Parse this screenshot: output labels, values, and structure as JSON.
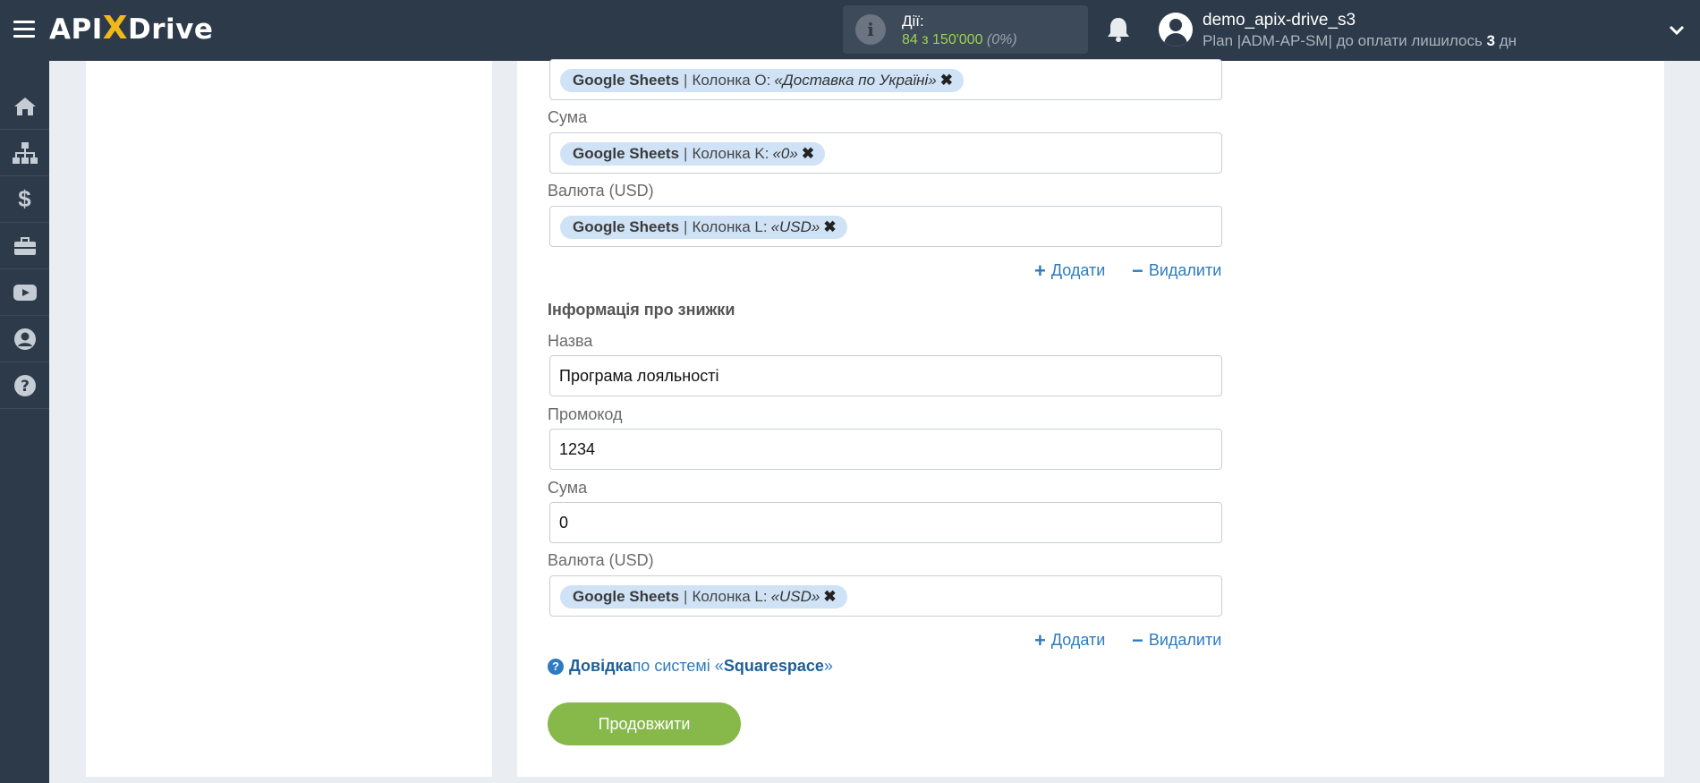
{
  "header": {
    "logo_prefix": "API",
    "logo_x": "X",
    "logo_suffix": "Drive",
    "actions_label": "Дії:",
    "actions_used": "84",
    "actions_of": " з 150'000 ",
    "actions_pct": "(0%)",
    "user_name": "demo_apix-drive_s3",
    "plan_prefix": "Plan |ADM-AP-SM| до оплати лишилось ",
    "plan_days": "3",
    "plan_suffix": " дн"
  },
  "sidebar": {
    "items": [
      "home-icon",
      "sitemap-icon",
      "dollar-icon",
      "briefcase-icon",
      "youtube-icon",
      "user-icon",
      "help-icon"
    ]
  },
  "form": {
    "row1": {
      "source": "Google Sheets",
      "column": "Колонка O:",
      "value": "«Доставка по Україні»"
    },
    "sum1": {
      "label": "Сума",
      "source": "Google Sheets",
      "column": "Колонка K:",
      "value": "«0»"
    },
    "currency1": {
      "label": "Валюта (USD)",
      "source": "Google Sheets",
      "column": "Колонка L:",
      "value": "«USD»"
    },
    "add_label": "Додати",
    "remove_label": "Видалити",
    "discount_title": "Інформація про знижки",
    "name": {
      "label": "Назва",
      "value": "Програма лояльності"
    },
    "promo": {
      "label": "Промокод",
      "value": "1234"
    },
    "sum2": {
      "label": "Сума",
      "value": "0"
    },
    "currency2": {
      "label": "Валюта (USD)",
      "source": "Google Sheets",
      "column": "Колонка L:",
      "value": "«USD»"
    },
    "help_bold": "Довідка",
    "help_mid": " по системі «",
    "help_system": "Squarespace",
    "help_end": "»",
    "continue_label": "Продовжити"
  },
  "colors": {
    "topbar": "#2d3a49",
    "accent_green": "#86b94a",
    "link_blue": "#2e7bbf",
    "tag_bg": "#cfe2f6"
  }
}
